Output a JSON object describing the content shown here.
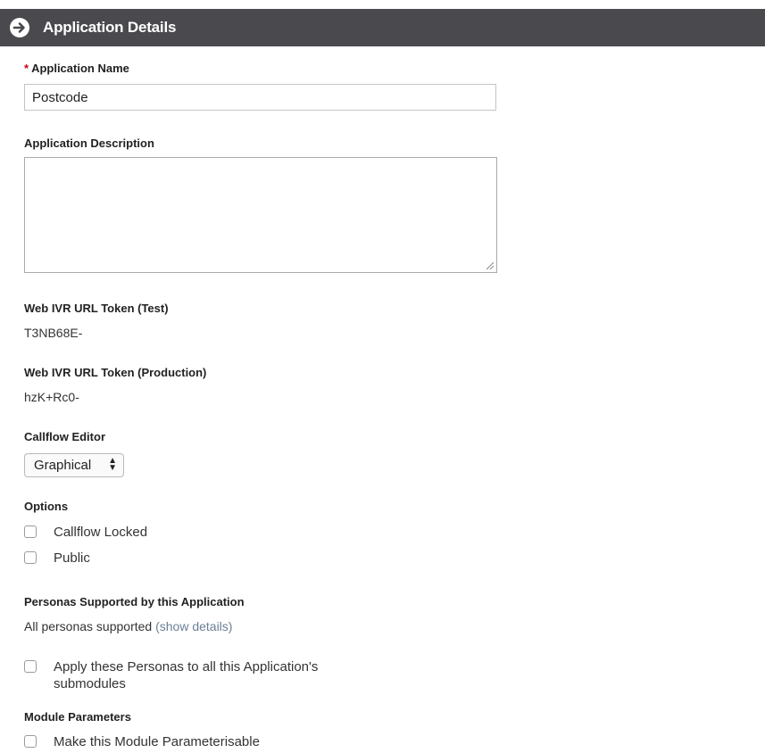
{
  "header": {
    "title": "Application Details",
    "icon": "arrow-right-circle-icon",
    "background": "#4a4a4e"
  },
  "form": {
    "app_name": {
      "required_marker": "*",
      "label": "Application Name",
      "value": "Postcode"
    },
    "app_description": {
      "label": "Application Description",
      "value": ""
    },
    "ivr_token_test": {
      "label": "Web IVR URL Token (Test)",
      "value": "T3NB68E-"
    },
    "ivr_token_production": {
      "label": "Web IVR URL Token (Production)",
      "value": "hzK+Rc0-"
    },
    "callflow_editor": {
      "label": "Callflow Editor",
      "selected": "Graphical"
    },
    "options": {
      "label": "Options",
      "items": [
        {
          "label": "Callflow Locked",
          "checked": false
        },
        {
          "label": "Public",
          "checked": false
        }
      ]
    },
    "personas": {
      "label": "Personas Supported by this Application",
      "summary": "All personas supported",
      "details_link": "(show details)",
      "apply_label_line1": "Apply these Personas to all this Application's",
      "apply_label_line2": "submodules",
      "apply_checked": false
    },
    "module_parameters": {
      "label": "Module Parameters",
      "checkbox_label": "Make this Module Parameterisable",
      "checked": false
    }
  }
}
